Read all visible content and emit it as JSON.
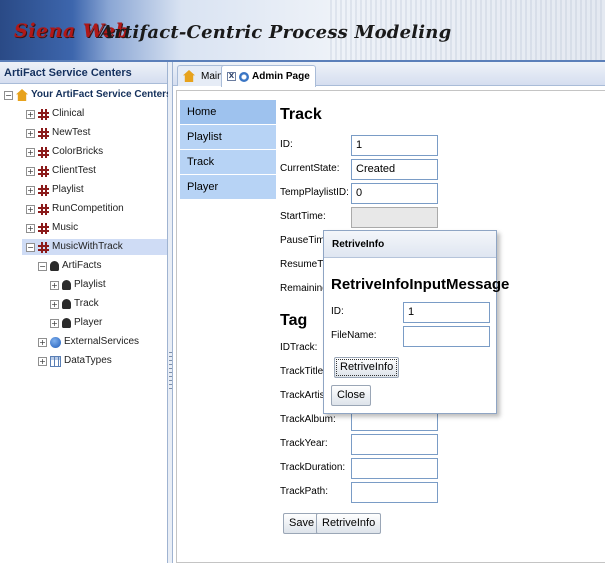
{
  "banner": {
    "logo": "Siena Web",
    "title": "Artifact-Centric Process Modeling"
  },
  "left_panel": {
    "header": "ArtiFact Service Centers",
    "tree": {
      "root": "Your ArtiFact Service Centers",
      "items": [
        "Clinical",
        "NewTest",
        "ColorBricks",
        "ClientTest",
        "Playlist",
        "RunCompetition",
        "Music",
        "MusicWithTrack"
      ],
      "artifacts_label": "ArtiFacts",
      "artifacts": [
        "Playlist",
        "Track",
        "Player"
      ],
      "external_services": "ExternalServices",
      "data_types": "DataTypes"
    }
  },
  "tabs": [
    {
      "label": "Main"
    },
    {
      "label": "Admin Page"
    }
  ],
  "nav": [
    "Home",
    "Playlist",
    "Track",
    "Player"
  ],
  "track_form": {
    "heading": "Track",
    "fields": [
      {
        "label": "ID:",
        "value": "1"
      },
      {
        "label": "CurrentState:",
        "value": "Created"
      },
      {
        "label": "TempPlaylistID:",
        "value": "0"
      },
      {
        "label": "StartTime:",
        "value": ""
      },
      {
        "label": "PauseTime:",
        "value": ""
      },
      {
        "label": "ResumeTime:",
        "value": ""
      },
      {
        "label": "RemainingDu",
        "value": ""
      }
    ]
  },
  "tag_form": {
    "heading": "Tag",
    "fields": [
      {
        "label": "IDTrack:",
        "value": ""
      },
      {
        "label": "TrackTitle:",
        "value": ""
      },
      {
        "label": "TrackArtist:",
        "value": ""
      },
      {
        "label": "TrackAlbum:",
        "value": ""
      },
      {
        "label": "TrackYear:",
        "value": ""
      },
      {
        "label": "TrackDuration:",
        "value": ""
      },
      {
        "label": "TrackPath:",
        "value": ""
      }
    ],
    "save_label": "Save",
    "retrive_label": "RetriveInfo"
  },
  "dialog": {
    "title": "RetriveInfo",
    "heading": "RetriveInfoInputMessage",
    "id_label": "ID:",
    "id_value": "1",
    "filename_label": "FileName:",
    "filename_value": "",
    "retrive_button": "RetriveInfo",
    "close_button": "Close"
  }
}
